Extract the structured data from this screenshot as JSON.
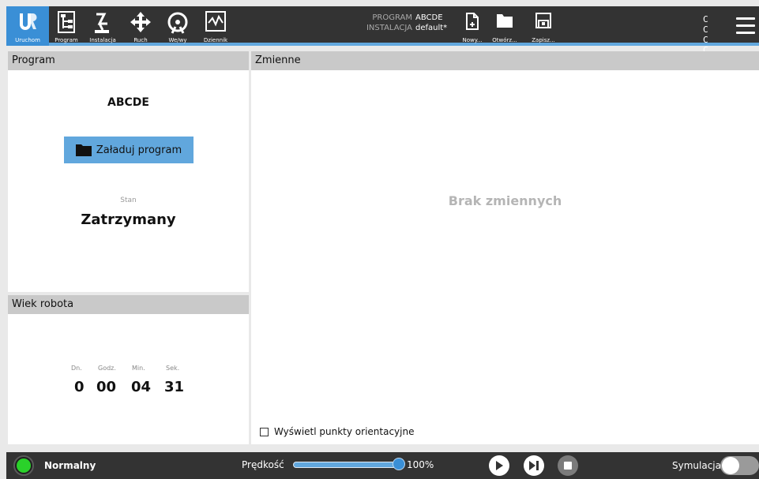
{
  "nav": {
    "run": "Uruchom",
    "program": "Program",
    "installation": "Instalacja",
    "move": "Ruch",
    "io": "We/wy",
    "log": "Dziennik"
  },
  "program_info": {
    "program_label": "PROGRAM",
    "program_value": "ABCDE",
    "installation_label": "INSTALACJA",
    "installation_value": "default*"
  },
  "file": {
    "new": "Nowy...",
    "open": "Otwórz...",
    "save": "Zapisz..."
  },
  "cc": {
    "line1": "C C",
    "line2": "C C"
  },
  "program_panel": {
    "title": "Program",
    "name": "ABCDE",
    "load_button": "Załaduj program",
    "state_label": "Stan",
    "state_value": "Zatrzymany"
  },
  "age_panel": {
    "title": "Wiek robota",
    "labels": [
      "Dn.",
      "Godz.",
      "Min.",
      "Sek."
    ],
    "values": [
      "0",
      "00",
      "04",
      "31"
    ]
  },
  "vars_panel": {
    "title": "Zmienne",
    "empty_text": "Brak zmiennych",
    "checkbox_label": "Wyświetl punkty orientacyjne"
  },
  "footer": {
    "status": "Normalny",
    "status_color": "#2ad12a",
    "speed_label": "Prędkość",
    "speed_value": "100%",
    "speed_fraction": 1.0,
    "sim_label": "Symulacja"
  },
  "colors": {
    "accent": "#61a7dd",
    "header_bg": "#333333"
  }
}
